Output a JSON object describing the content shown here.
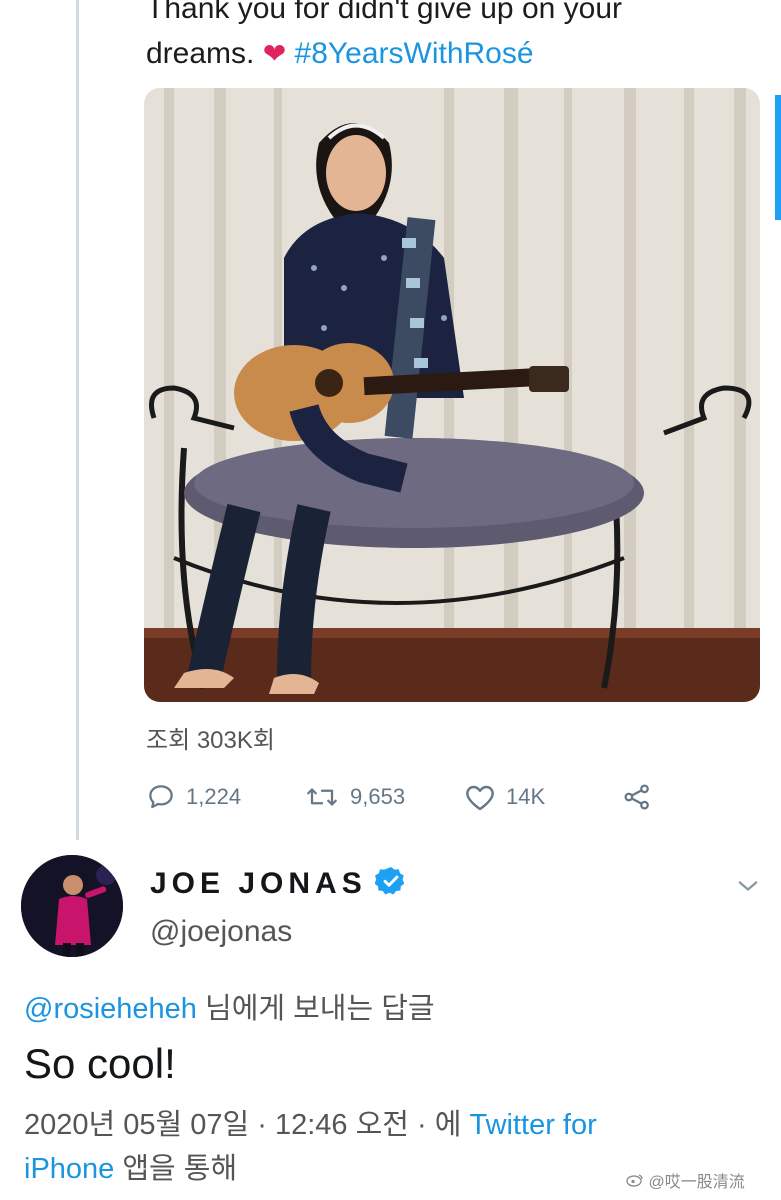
{
  "tweet": {
    "text_lines": [
      "Thank you for didn't give up on your",
      "dreams."
    ],
    "heart_emoji": "❤",
    "hashtag": "#8YearsWithRosé",
    "views": "조회 303K회",
    "stats": {
      "replies": "1,224",
      "retweets": "9,653",
      "likes": "14K"
    }
  },
  "reply": {
    "display_name": "JOE JONAS",
    "handle": "@joejonas",
    "replying_to_mention": "@rosieheheh",
    "replying_to_suffix": " 님에게 보내는 답글",
    "text": "So cool!",
    "meta_prefix": "2020년 05월 07일 · 12:46 오전 · 에 ",
    "client_part1": "Twitter for",
    "client_part2": "iPhone",
    "meta_suffix": " 앱을 통해"
  },
  "watermark": "@哎一股清流",
  "colors": {
    "link": "#1b95e0",
    "verified": "#1da1f2",
    "heart": "#e0245e",
    "muted": "#657786"
  },
  "icons": [
    "reply-icon",
    "retweet-icon",
    "like-icon",
    "share-icon",
    "verified-badge-icon",
    "chevron-down-icon",
    "weibo-icon"
  ]
}
